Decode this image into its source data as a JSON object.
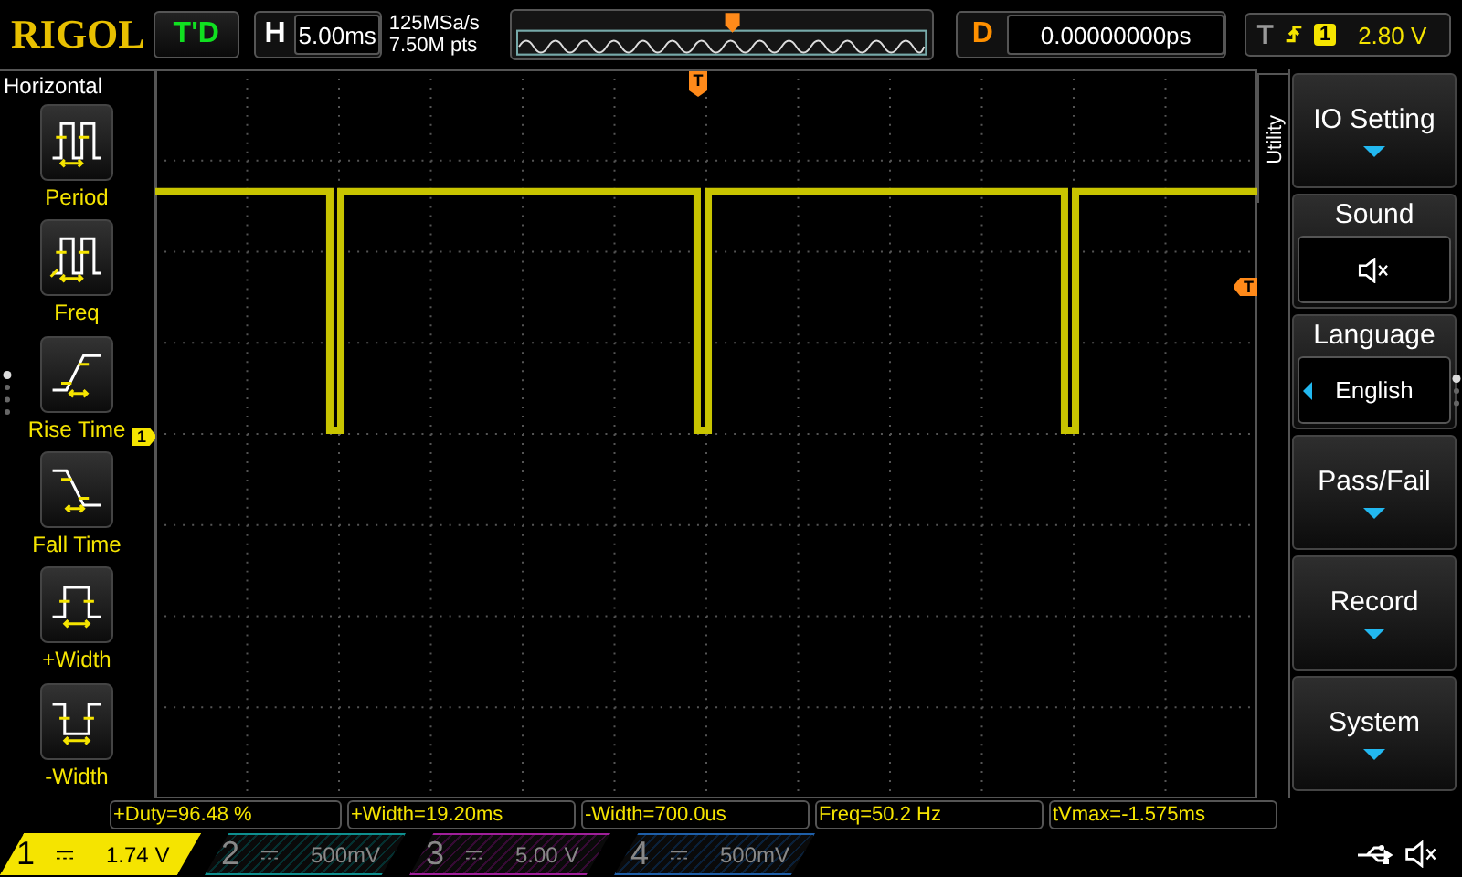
{
  "top_bar": {
    "logo": "RIGOL",
    "run_status": "T'D",
    "timebase": {
      "label": "H",
      "value": "5.00ms"
    },
    "sample_rate": "125MSa/s",
    "memory_depth": "7.50M pts",
    "delay": {
      "label": "D",
      "value": "0.00000000ps"
    },
    "trigger": {
      "label": "T",
      "channel": "1",
      "level": "2.80 V"
    }
  },
  "left_menu": {
    "title": "Horizontal",
    "items": [
      {
        "kind": "period",
        "label": "Period"
      },
      {
        "kind": "freq",
        "label": "Freq"
      },
      {
        "kind": "rise",
        "label": "Rise Time"
      },
      {
        "kind": "fall",
        "label": "Fall Time"
      },
      {
        "kind": "pwidth",
        "label": "+Width"
      },
      {
        "kind": "nwidth",
        "label": "-Width"
      }
    ]
  },
  "markers": {
    "channel": "1",
    "trigger_position": "T",
    "trigger_level": "T"
  },
  "right_menu": {
    "title": "Utility",
    "items": [
      {
        "kind": "submenu",
        "label": "IO Setting"
      },
      {
        "kind": "sound",
        "label": "Sound",
        "muted": true
      },
      {
        "kind": "choice",
        "label": "Language",
        "value": "English"
      },
      {
        "kind": "submenu",
        "label": "Pass/Fail"
      },
      {
        "kind": "submenu",
        "label": "Record"
      },
      {
        "kind": "submenu",
        "label": "System"
      }
    ]
  },
  "measurements": [
    "+Duty=96.48 %",
    "+Width=19.20ms",
    "-Width=700.0us",
    "Freq=50.2 Hz",
    "tVmax=-1.575ms"
  ],
  "channels": [
    {
      "number": "1",
      "value": "1.74 V",
      "on": true,
      "color": "#f5e400"
    },
    {
      "number": "2",
      "value": "500mV",
      "on": false,
      "color": "#0f8f8f"
    },
    {
      "number": "3",
      "value": "5.00 V",
      "on": false,
      "color": "#a0209a"
    },
    {
      "number": "4",
      "value": "500mV",
      "on": false,
      "color": "#1f5fa8"
    }
  ]
}
